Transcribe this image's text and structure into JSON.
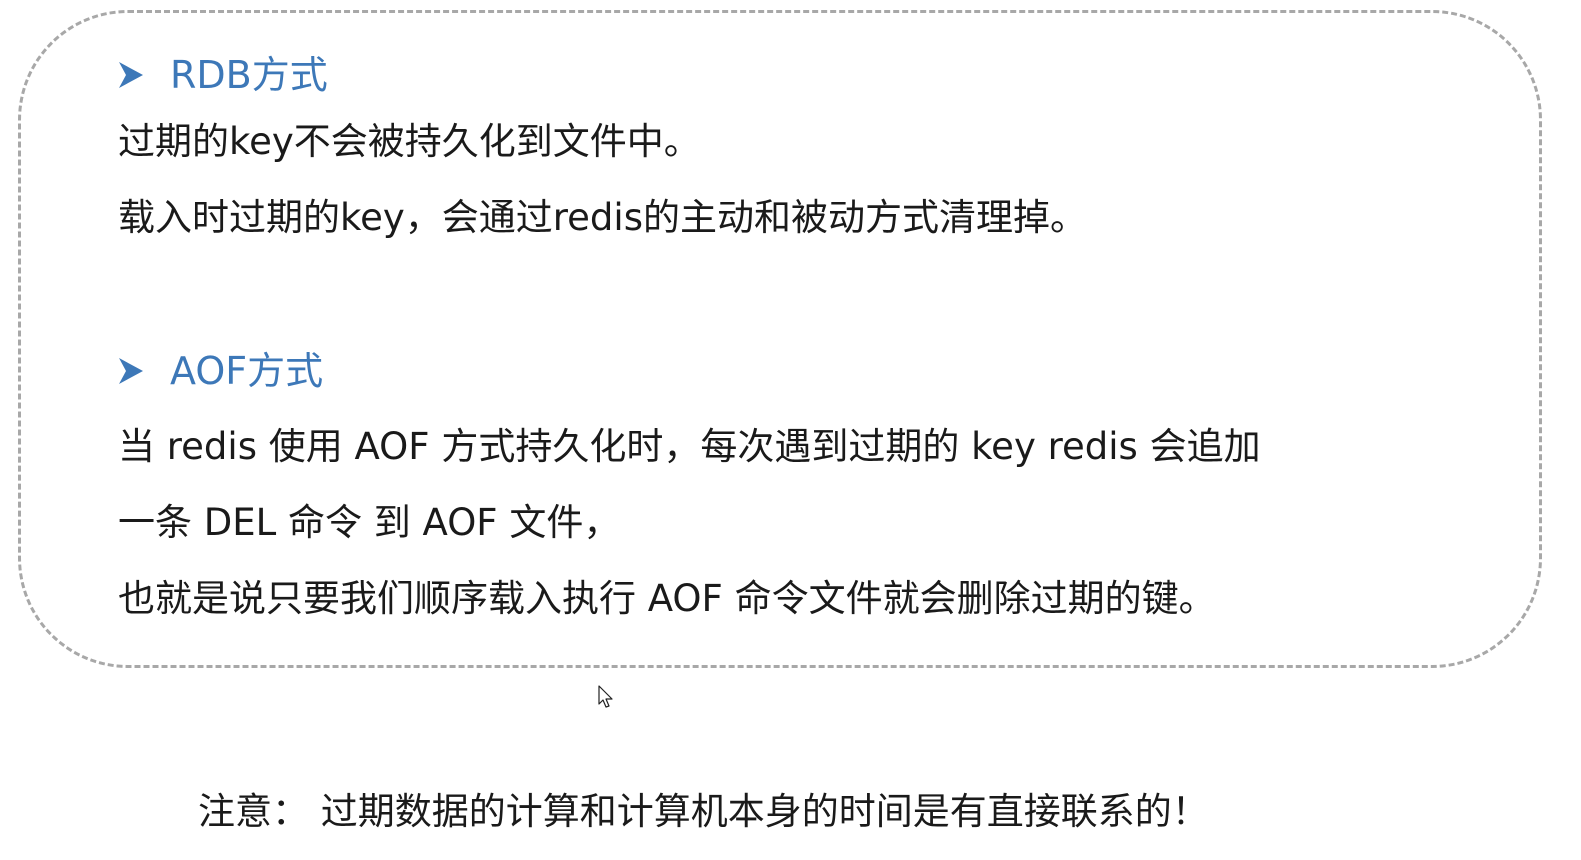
{
  "rdb": {
    "heading": "RDB方式",
    "lines": [
      "过期的key不会被持久化到文件中。",
      "载入时过期的key，会通过redis的主动和被动方式清理掉。"
    ]
  },
  "aof": {
    "heading": "AOF方式",
    "lines": [
      "当 redis 使用 AOF 方式持久化时，每次遇到过期的 key redis 会追加",
      "一条 DEL 命令 到 AOF 文件，",
      "也就是说只要我们顺序载入执行 AOF 命令文件就会删除过期的键。"
    ]
  },
  "note": "注意： 过期数据的计算和计算机本身的时间是有直接联系的！",
  "colors": {
    "heading": "#3d78b8",
    "text": "#1a1a1a",
    "border": "#a8a8a8"
  },
  "icons": {
    "bullet": "arrow-bullet-icon",
    "cursor": "mouse-pointer-icon"
  }
}
